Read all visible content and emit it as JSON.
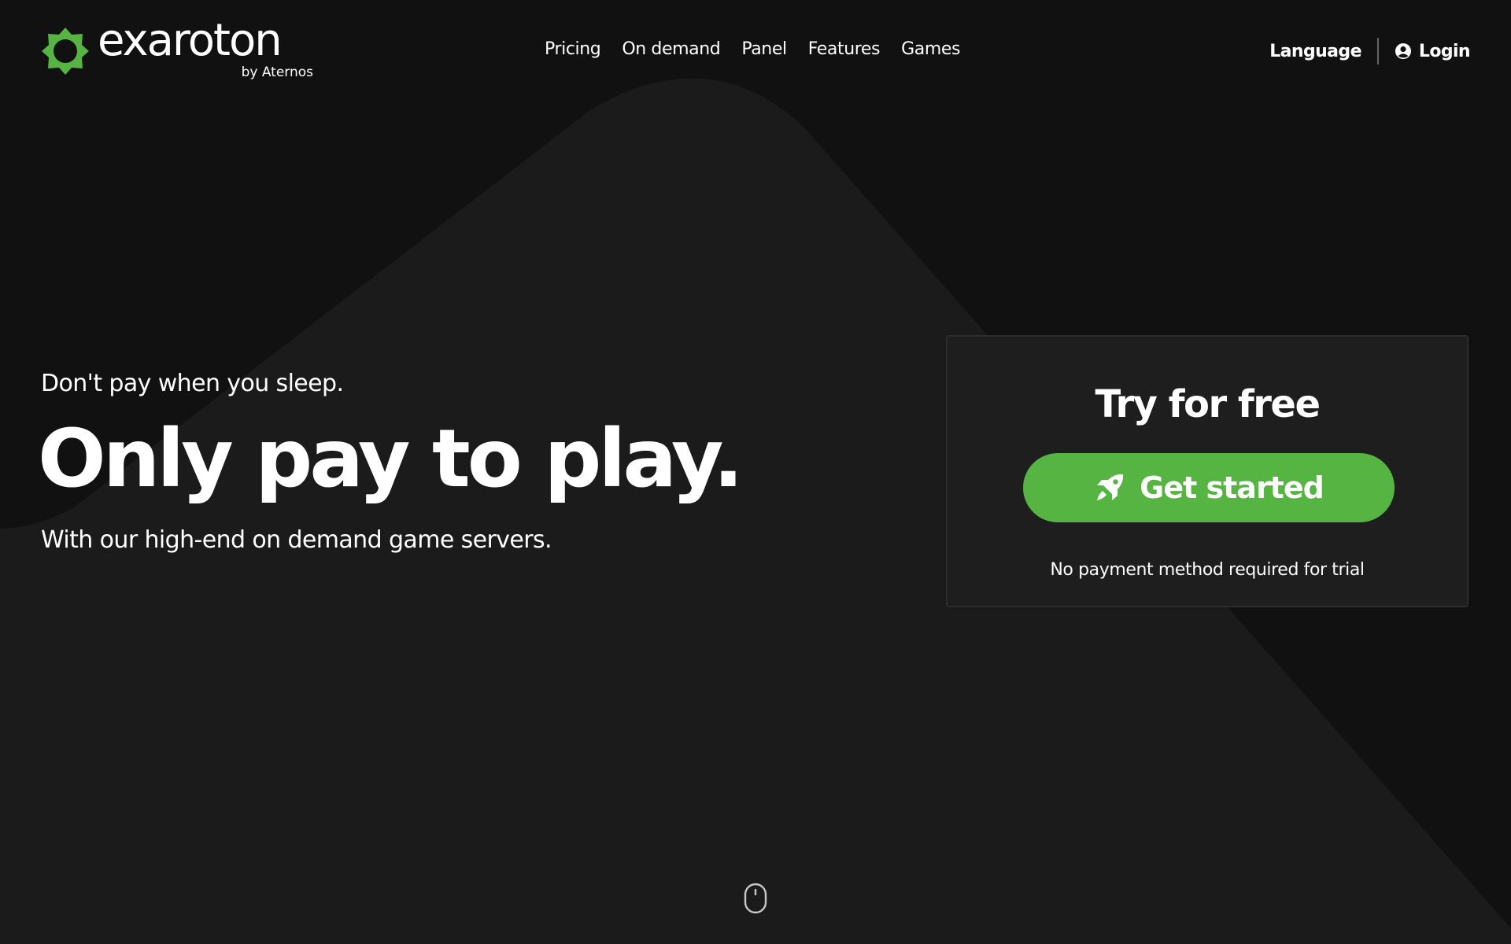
{
  "brand": {
    "name": "exaroton",
    "byline": "by Aternos",
    "color": "#56b442"
  },
  "nav": {
    "items": [
      {
        "label": "Pricing"
      },
      {
        "label": "On demand"
      },
      {
        "label": "Panel"
      },
      {
        "label": "Features"
      },
      {
        "label": "Games"
      }
    ],
    "language_label": "Language",
    "login_label": "Login"
  },
  "hero": {
    "tagline": "Don't pay when you sleep.",
    "headline": "Only pay to play.",
    "subline": "With our high-end on demand game servers."
  },
  "trial": {
    "title": "Try for free",
    "cta_label": "Get started",
    "cta_icon": "rocket-icon",
    "note": "No payment method required for trial"
  },
  "icons": {
    "login": "user-circle-icon",
    "scroll": "mouse-scroll-icon"
  },
  "colors": {
    "background": "#111111",
    "shape": "#1b1b1b",
    "card": "#1e1e1e",
    "accent": "#56b442"
  }
}
